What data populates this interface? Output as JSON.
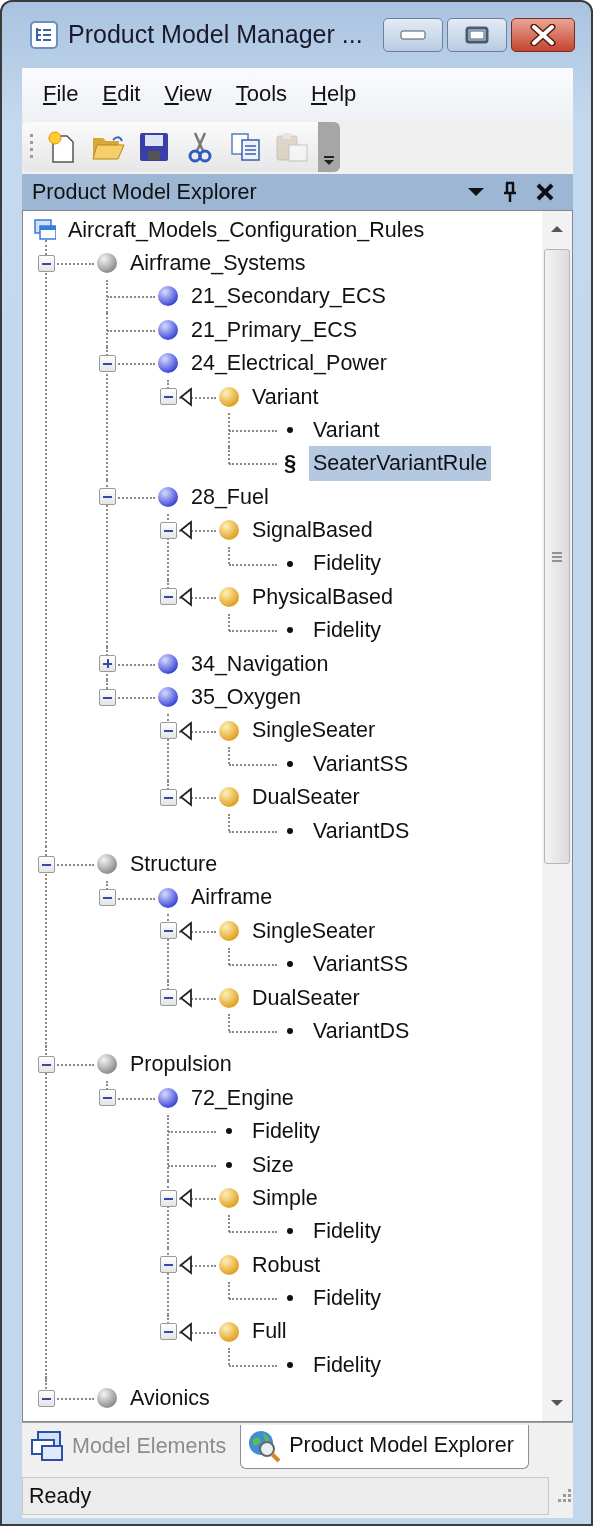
{
  "window": {
    "title": "Product Model Manager ..."
  },
  "menu": [
    "File",
    "Edit",
    "View",
    "Tools",
    "Help"
  ],
  "toolbar": [
    {
      "kind": "new",
      "disabled": false
    },
    {
      "kind": "open",
      "disabled": false
    },
    {
      "kind": "save",
      "disabled": false
    },
    {
      "kind": "cut",
      "disabled": false
    },
    {
      "kind": "copy",
      "disabled": false
    },
    {
      "kind": "paste",
      "disabled": true
    }
  ],
  "panel": {
    "title": "Product Model Explorer"
  },
  "tree": {
    "label": "Aircraft_Models_Configuration_Rules",
    "kind": "root",
    "selected": false,
    "children": [
      {
        "label": "Airframe_Systems",
        "kind": "group",
        "expanded": true,
        "selected": false,
        "children": [
          {
            "label": "21_Secondary_ECS",
            "kind": "system",
            "selected": false
          },
          {
            "label": "21_Primary_ECS",
            "kind": "system",
            "selected": false
          },
          {
            "label": "24_Electrical_Power",
            "kind": "system",
            "expanded": true,
            "selected": false,
            "children": [
              {
                "label": "Variant",
                "kind": "variant",
                "expanded": true,
                "selected": false,
                "children": [
                  {
                    "label": "Variant",
                    "kind": "property",
                    "selected": false
                  },
                  {
                    "label": "SeaterVariantRule",
                    "kind": "rule",
                    "marker": "§",
                    "selected": true
                  }
                ]
              }
            ]
          },
          {
            "label": "28_Fuel",
            "kind": "system",
            "expanded": true,
            "selected": false,
            "children": [
              {
                "label": "SignalBased",
                "kind": "variant",
                "expanded": true,
                "selected": false,
                "children": [
                  {
                    "label": "Fidelity",
                    "kind": "property",
                    "selected": false
                  }
                ]
              },
              {
                "label": "PhysicalBased",
                "kind": "variant",
                "expanded": true,
                "selected": false,
                "children": [
                  {
                    "label": "Fidelity",
                    "kind": "property",
                    "selected": false
                  }
                ]
              }
            ]
          },
          {
            "label": "34_Navigation",
            "kind": "system",
            "expanded": false,
            "selected": false
          },
          {
            "label": "35_Oxygen",
            "kind": "system",
            "expanded": true,
            "selected": false,
            "children": [
              {
                "label": "SingleSeater",
                "kind": "variant",
                "expanded": true,
                "selected": false,
                "children": [
                  {
                    "label": "VariantSS",
                    "kind": "property",
                    "selected": false
                  }
                ]
              },
              {
                "label": "DualSeater",
                "kind": "variant",
                "expanded": true,
                "selected": false,
                "children": [
                  {
                    "label": "VariantDS",
                    "kind": "property",
                    "selected": false
                  }
                ]
              }
            ]
          }
        ]
      },
      {
        "label": "Structure",
        "kind": "group",
        "expanded": true,
        "selected": false,
        "children": [
          {
            "label": "Airframe",
            "kind": "system",
            "expanded": true,
            "selected": false,
            "children": [
              {
                "label": "SingleSeater",
                "kind": "variant",
                "expanded": true,
                "selected": false,
                "children": [
                  {
                    "label": "VariantSS",
                    "kind": "property",
                    "selected": false
                  }
                ]
              },
              {
                "label": "DualSeater",
                "kind": "variant",
                "expanded": true,
                "selected": false,
                "children": [
                  {
                    "label": "VariantDS",
                    "kind": "property",
                    "selected": false
                  }
                ]
              }
            ]
          }
        ]
      },
      {
        "label": "Propulsion",
        "kind": "group",
        "expanded": true,
        "selected": false,
        "children": [
          {
            "label": "72_Engine",
            "kind": "system",
            "expanded": true,
            "selected": false,
            "children": [
              {
                "label": "Fidelity",
                "kind": "property",
                "selected": false
              },
              {
                "label": "Size",
                "kind": "property",
                "selected": false
              },
              {
                "label": "Simple",
                "kind": "variant",
                "expanded": true,
                "selected": false,
                "children": [
                  {
                    "label": "Fidelity",
                    "kind": "property",
                    "selected": false
                  }
                ]
              },
              {
                "label": "Robust",
                "kind": "variant",
                "expanded": true,
                "selected": false,
                "children": [
                  {
                    "label": "Fidelity",
                    "kind": "property",
                    "selected": false
                  }
                ]
              },
              {
                "label": "Full",
                "kind": "variant",
                "expanded": true,
                "selected": false,
                "children": [
                  {
                    "label": "Fidelity",
                    "kind": "property",
                    "selected": false
                  }
                ]
              }
            ]
          }
        ]
      },
      {
        "label": "Avionics",
        "kind": "group",
        "expanded": true,
        "selected": false
      }
    ]
  },
  "tabs": [
    {
      "label": "Model Elements",
      "selected": false
    },
    {
      "label": "Product Model Explorer",
      "selected": true
    }
  ],
  "status_bar": "Ready"
}
